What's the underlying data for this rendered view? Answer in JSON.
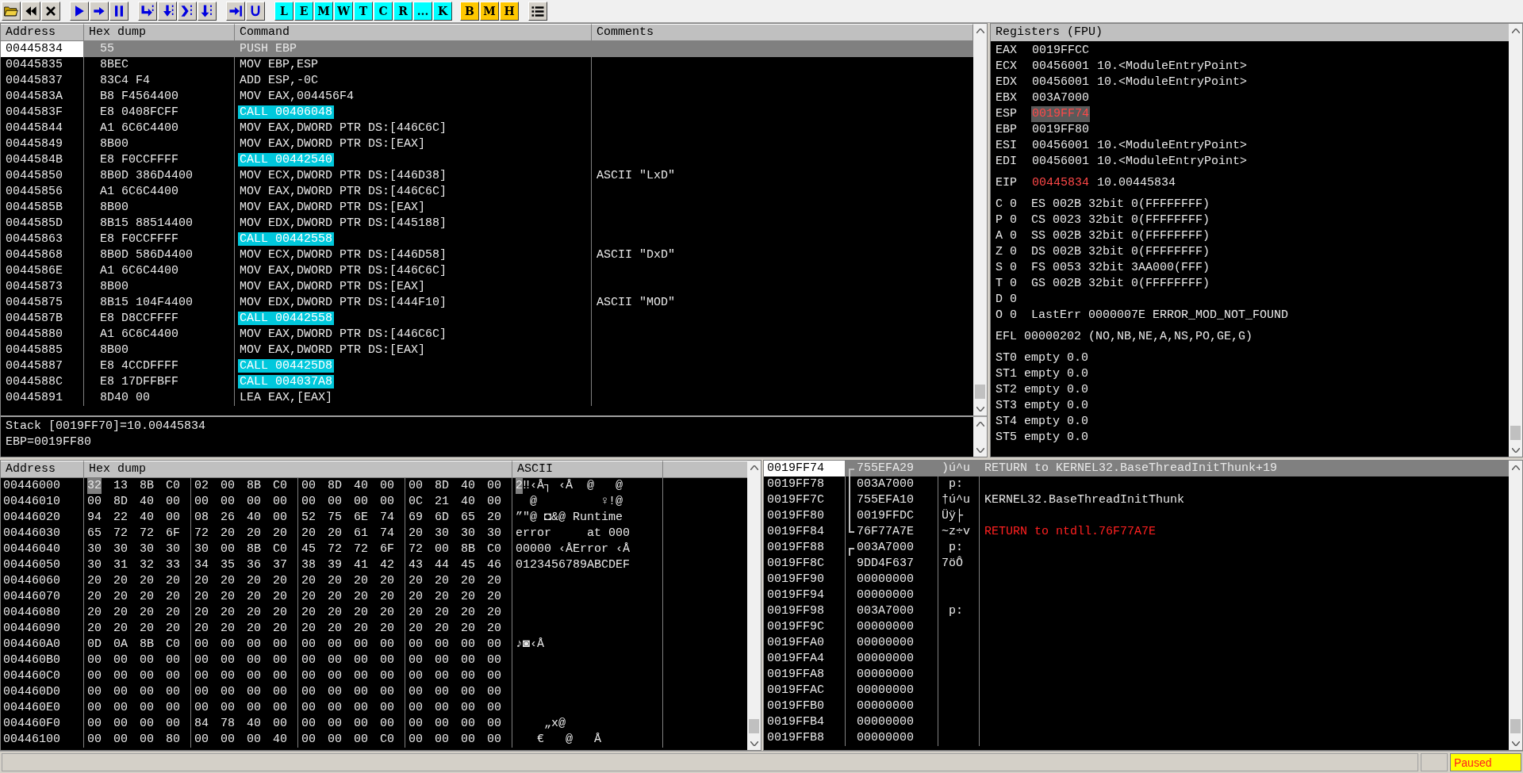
{
  "toolbar": {
    "window_buttons": [
      {
        "label": "L",
        "color": "#00ffff"
      },
      {
        "label": "E",
        "color": "#00ffff"
      },
      {
        "label": "M",
        "color": "#00ffff"
      },
      {
        "label": "W",
        "color": "#00ffff"
      },
      {
        "label": "T",
        "color": "#00ffff"
      },
      {
        "label": "C",
        "color": "#00ffff"
      },
      {
        "label": "R",
        "color": "#00ffff"
      },
      {
        "label": "...",
        "color": "#00ffff"
      },
      {
        "label": "K",
        "color": "#00ffff"
      },
      {
        "label": "B",
        "color": "#ffc800"
      },
      {
        "label": "M",
        "color": "#ffc800"
      },
      {
        "label": "H",
        "color": "#ffc800"
      }
    ]
  },
  "disassembly": {
    "columns": [
      "Address",
      "Hex dump",
      "Command",
      "Comments"
    ],
    "rows": [
      {
        "address": "00445834",
        "hex": "55",
        "command": "PUSH EBP",
        "kind": "plain",
        "selected": true
      },
      {
        "address": "00445835",
        "hex": "8BEC",
        "command": "MOV EBP,ESP",
        "kind": "plain",
        "selected": false
      },
      {
        "address": "00445837",
        "hex": "83C4 F4",
        "command": "ADD ESP,-0C",
        "kind": "plain",
        "selected": false
      },
      {
        "address": "0044583A",
        "hex": "B8 F4564400",
        "command": "MOV EAX,004456F4",
        "kind": "plain",
        "selected": false
      },
      {
        "address": "0044583F",
        "hex": "E8 0408FCFF",
        "command": "CALL 00406048",
        "kind": "call",
        "selected": false
      },
      {
        "address": "00445844",
        "hex": "A1 6C6C4400",
        "command": "MOV EAX,DWORD PTR DS:[446C6C]",
        "kind": "plain",
        "selected": false
      },
      {
        "address": "00445849",
        "hex": "8B00",
        "command": "MOV EAX,DWORD PTR DS:[EAX]",
        "kind": "plain",
        "selected": false
      },
      {
        "address": "0044584B",
        "hex": "E8 F0CCFFFF",
        "command": "CALL 00442540",
        "kind": "call",
        "selected": false
      },
      {
        "address": "00445850",
        "hex": "8B0D 386D4400",
        "command": "MOV ECX,DWORD PTR DS:[446D38]",
        "comment": "ASCII \"LxD\"",
        "kind": "plain",
        "selected": false
      },
      {
        "address": "00445856",
        "hex": "A1 6C6C4400",
        "command": "MOV EAX,DWORD PTR DS:[446C6C]",
        "kind": "plain",
        "selected": false
      },
      {
        "address": "0044585B",
        "hex": "8B00",
        "command": "MOV EAX,DWORD PTR DS:[EAX]",
        "kind": "plain",
        "selected": false
      },
      {
        "address": "0044585D",
        "hex": "8B15 88514400",
        "command": "MOV EDX,DWORD PTR DS:[445188]",
        "kind": "plain",
        "selected": false
      },
      {
        "address": "00445863",
        "hex": "E8 F0CCFFFF",
        "command": "CALL 00442558",
        "kind": "call",
        "selected": false
      },
      {
        "address": "00445868",
        "hex": "8B0D 586D4400",
        "command": "MOV ECX,DWORD PTR DS:[446D58]",
        "comment": "ASCII \"DxD\"",
        "kind": "plain",
        "selected": false
      },
      {
        "address": "0044586E",
        "hex": "A1 6C6C4400",
        "command": "MOV EAX,DWORD PTR DS:[446C6C]",
        "kind": "plain",
        "selected": false
      },
      {
        "address": "00445873",
        "hex": "8B00",
        "command": "MOV EAX,DWORD PTR DS:[EAX]",
        "kind": "plain",
        "selected": false
      },
      {
        "address": "00445875",
        "hex": "8B15 104F4400",
        "command": "MOV EDX,DWORD PTR DS:[444F10]",
        "comment": "ASCII \"MOD\"",
        "kind": "plain",
        "selected": false
      },
      {
        "address": "0044587B",
        "hex": "E8 D8CCFFFF",
        "command": "CALL 00442558",
        "kind": "call",
        "selected": false
      },
      {
        "address": "00445880",
        "hex": "A1 6C6C4400",
        "command": "MOV EAX,DWORD PTR DS:[446C6C]",
        "kind": "plain",
        "selected": false
      },
      {
        "address": "00445885",
        "hex": "8B00",
        "command": "MOV EAX,DWORD PTR DS:[EAX]",
        "kind": "plain",
        "selected": false
      },
      {
        "address": "00445887",
        "hex": "E8 4CCDFFFF",
        "command": "CALL 004425D8",
        "kind": "call",
        "selected": false
      },
      {
        "address": "0044588C",
        "hex": "E8 17DFFBFF",
        "command": "CALL 004037A8",
        "kind": "call",
        "selected": false
      },
      {
        "address": "00445891",
        "hex": "8D40 00",
        "command": "LEA EAX,[EAX]",
        "kind": "plain",
        "selected": false
      }
    ],
    "info": [
      "Stack [0019FF70]=10.00445834",
      "EBP=0019FF80"
    ]
  },
  "registers": {
    "title": "Registers (FPU)",
    "sections": [
      [
        {
          "kind": "reg",
          "name": "EAX",
          "value": "0019FFCC",
          "changed": false,
          "selected": false
        },
        {
          "kind": "reg",
          "name": "ECX",
          "value": "00456001",
          "comment": "10.<ModuleEntryPoint>",
          "changed": false,
          "selected": false
        },
        {
          "kind": "reg",
          "name": "EDX",
          "value": "00456001",
          "comment": "10.<ModuleEntryPoint>",
          "changed": false,
          "selected": false
        },
        {
          "kind": "reg",
          "name": "EBX",
          "value": "003A7000",
          "changed": false,
          "selected": false
        },
        {
          "kind": "reg",
          "name": "ESP",
          "value": "0019FF74",
          "changed": true,
          "selected": true
        },
        {
          "kind": "reg",
          "name": "EBP",
          "value": "0019FF80",
          "changed": false,
          "selected": false
        },
        {
          "kind": "reg",
          "name": "ESI",
          "value": "00456001",
          "comment": "10.<ModuleEntryPoint>",
          "changed": false,
          "selected": false
        },
        {
          "kind": "reg",
          "name": "EDI",
          "value": "00456001",
          "comment": "10.<ModuleEntryPoint>",
          "changed": false,
          "selected": false
        }
      ],
      [
        {
          "kind": "reg",
          "name": "EIP",
          "value": "00445834",
          "comment": "10.00445834",
          "changed": true,
          "selected": false
        }
      ],
      [
        {
          "kind": "text",
          "text": "C 0  ES 002B 32bit 0(FFFFFFFF)"
        },
        {
          "kind": "text",
          "text": "P 0  CS 0023 32bit 0(FFFFFFFF)"
        },
        {
          "kind": "text",
          "text": "A 0  SS 002B 32bit 0(FFFFFFFF)"
        },
        {
          "kind": "text",
          "text": "Z 0  DS 002B 32bit 0(FFFFFFFF)"
        },
        {
          "kind": "text",
          "text": "S 0  FS 0053 32bit 3AA000(FFF)"
        },
        {
          "kind": "text",
          "text": "T 0  GS 002B 32bit 0(FFFFFFFF)"
        },
        {
          "kind": "text",
          "text": "D 0"
        },
        {
          "kind": "text",
          "text": "O 0  LastErr 0000007E ERROR_MOD_NOT_FOUND"
        }
      ],
      [
        {
          "kind": "text",
          "text": "EFL 00000202 (NO,NB,NE,A,NS,PO,GE,G)"
        }
      ],
      [
        {
          "kind": "text",
          "text": "ST0 empty 0.0"
        },
        {
          "kind": "text",
          "text": "ST1 empty 0.0"
        },
        {
          "kind": "text",
          "text": "ST2 empty 0.0"
        },
        {
          "kind": "text",
          "text": "ST3 empty 0.0"
        },
        {
          "kind": "text",
          "text": "ST4 empty 0.0"
        },
        {
          "kind": "text",
          "text": "ST5 empty 0.0"
        }
      ]
    ]
  },
  "dump": {
    "columns": [
      "Address",
      "Hex dump",
      "ASCII"
    ],
    "rows": [
      {
        "address": "00446000",
        "hex": "32 13 8B C0 02 00 8B C0 00 8D 40 00 00 8D 40 00",
        "ascii": "2‼‹Å┐ ‹Å  @   @",
        "selected": true
      },
      {
        "address": "00446010",
        "hex": "00 8D 40 00 00 00 00 00 00 00 00 00 0C 21 40 00",
        "ascii": "  @         ♀!@",
        "selected": false
      },
      {
        "address": "00446020",
        "hex": "94 22 40 00 08 26 40 00 52 75 6E 74 69 6D 65 20",
        "ascii": "”\"@ ◘&@ Runtime",
        "selected": false
      },
      {
        "address": "00446030",
        "hex": "65 72 72 6F 72 20 20 20 20 20 61 74 20 30 30 30",
        "ascii": "error     at 000",
        "selected": false
      },
      {
        "address": "00446040",
        "hex": "30 30 30 30 30 00 8B C0 45 72 72 6F 72 00 8B C0",
        "ascii": "00000 ‹ÅError ‹Å",
        "selected": false
      },
      {
        "address": "00446050",
        "hex": "30 31 32 33 34 35 36 37 38 39 41 42 43 44 45 46",
        "ascii": "0123456789ABCDEF",
        "selected": false
      },
      {
        "address": "00446060",
        "hex": "20 20 20 20 20 20 20 20 20 20 20 20 20 20 20 20",
        "selected": false
      },
      {
        "address": "00446070",
        "hex": "20 20 20 20 20 20 20 20 20 20 20 20 20 20 20 20",
        "selected": false
      },
      {
        "address": "00446080",
        "hex": "20 20 20 20 20 20 20 20 20 20 20 20 20 20 20 20",
        "selected": false
      },
      {
        "address": "00446090",
        "hex": "20 20 20 20 20 20 20 20 20 20 20 20 20 20 20 20",
        "selected": false
      },
      {
        "address": "004460A0",
        "hex": "0D 0A 8B C0 00 00 00 00 00 00 00 00 00 00 00 00",
        "ascii": "♪◙‹Å",
        "selected": false
      },
      {
        "address": "004460B0",
        "hex": "00 00 00 00 00 00 00 00 00 00 00 00 00 00 00 00",
        "selected": false
      },
      {
        "address": "004460C0",
        "hex": "00 00 00 00 00 00 00 00 00 00 00 00 00 00 00 00",
        "selected": false
      },
      {
        "address": "004460D0",
        "hex": "00 00 00 00 00 00 00 00 00 00 00 00 00 00 00 00",
        "selected": false
      },
      {
        "address": "004460E0",
        "hex": "00 00 00 00 00 00 00 00 00 00 00 00 00 00 00 00",
        "selected": false
      },
      {
        "address": "004460F0",
        "hex": "00 00 00 00 84 78 40 00 00 00 00 00 00 00 00 00",
        "ascii": "    „x@",
        "selected": false
      },
      {
        "address": "00446100",
        "hex": "00 00 00 80 00 00 00 40 00 00 00 C0 00 00 00 00",
        "ascii": "   €   @   Å",
        "selected": false
      }
    ]
  },
  "stack": {
    "rows": [
      {
        "address": "0019FF74",
        "value": "755EFA29",
        "ascii": ")ú^u",
        "comment": "RETURN to KERNEL32.BaseThreadInitThunk+19",
        "kind": "start",
        "highlight": false,
        "selected": true
      },
      {
        "address": "0019FF78",
        "value": "003A7000",
        "ascii": " p:",
        "kind": "mid",
        "selected": false
      },
      {
        "address": "0019FF7C",
        "value": "755EFA10",
        "ascii": "†ú^u",
        "comment": "KERNEL32.BaseThreadInitThunk",
        "kind": "mid",
        "highlight": false,
        "selected": false
      },
      {
        "address": "0019FF80",
        "value": "0019FFDC",
        "ascii": "Üÿ├",
        "kind": "mid",
        "selected": false
      },
      {
        "address": "0019FF84",
        "value": "76F77A7E",
        "ascii": "~z÷v",
        "comment": "RETURN to ntdll.76F77A7E",
        "kind": "end",
        "highlight": true,
        "selected": false
      },
      {
        "address": "0019FF88",
        "value": "003A7000",
        "ascii": " p:",
        "kind": "start",
        "selected": false
      },
      {
        "address": "0019FF8C",
        "value": "9DD4F637",
        "ascii": "7öÔ",
        "kind": "plain",
        "selected": false
      },
      {
        "address": "0019FF90",
        "value": "00000000",
        "kind": "plain",
        "selected": false
      },
      {
        "address": "0019FF94",
        "value": "00000000",
        "kind": "plain",
        "selected": false
      },
      {
        "address": "0019FF98",
        "value": "003A7000",
        "ascii": " p:",
        "kind": "plain",
        "selected": false
      },
      {
        "address": "0019FF9C",
        "value": "00000000",
        "kind": "plain",
        "selected": false
      },
      {
        "address": "0019FFA0",
        "value": "00000000",
        "kind": "plain",
        "selected": false
      },
      {
        "address": "0019FFA4",
        "value": "00000000",
        "kind": "plain",
        "selected": false
      },
      {
        "address": "0019FFA8",
        "value": "00000000",
        "kind": "plain",
        "selected": false
      },
      {
        "address": "0019FFAC",
        "value": "00000000",
        "kind": "plain",
        "selected": false
      },
      {
        "address": "0019FFB0",
        "value": "00000000",
        "kind": "plain",
        "selected": false
      },
      {
        "address": "0019FFB4",
        "value": "00000000",
        "kind": "plain",
        "selected": false
      },
      {
        "address": "0019FFB8",
        "value": "00000000",
        "kind": "plain",
        "selected": false
      }
    ]
  },
  "status_bar": {
    "state": "Paused"
  }
}
